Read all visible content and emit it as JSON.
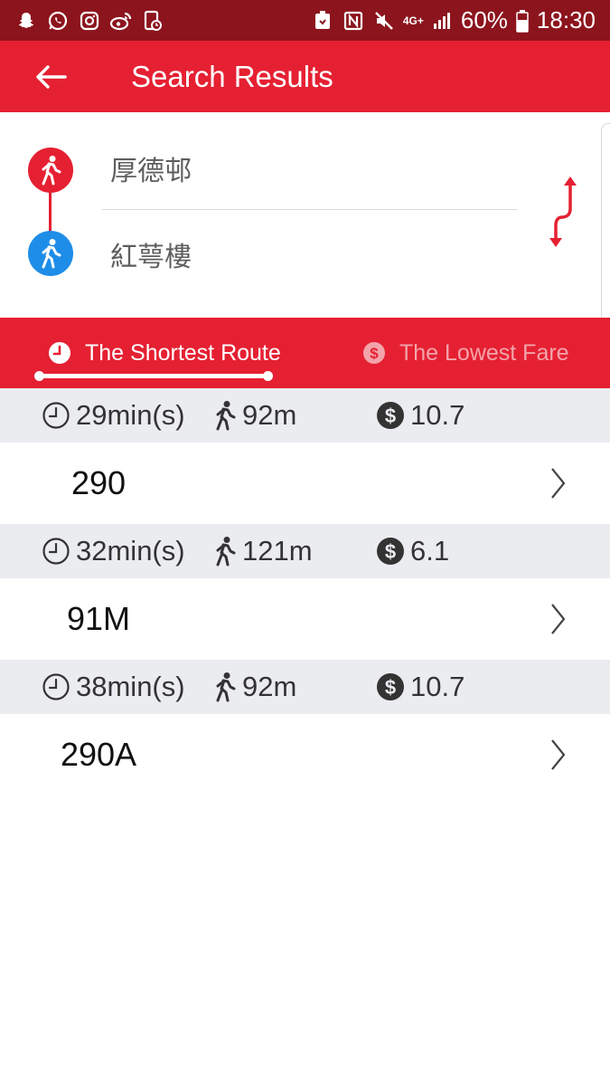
{
  "statusbar": {
    "battery": "60%",
    "time": "18:30",
    "network": "4G+"
  },
  "appbar": {
    "title": "Search Results"
  },
  "origin_destination": {
    "from": "厚德邨",
    "to": "紅萼樓"
  },
  "tabs": [
    {
      "label": "The Shortest Route",
      "active": true
    },
    {
      "label": "The Lowest Fare",
      "active": false
    }
  ],
  "results": [
    {
      "time": "29min(s)",
      "walk": "92m",
      "fare": "10.7",
      "route": "290"
    },
    {
      "time": "32min(s)",
      "walk": "121m",
      "fare": "6.1",
      "route": "91M"
    },
    {
      "time": "38min(s)",
      "walk": "92m",
      "fare": "10.7",
      "route": "290A"
    }
  ],
  "colors": {
    "primary": "#e52032",
    "status": "#8c141d",
    "destination": "#1e8de8",
    "summary_bg": "#ebecf0"
  }
}
